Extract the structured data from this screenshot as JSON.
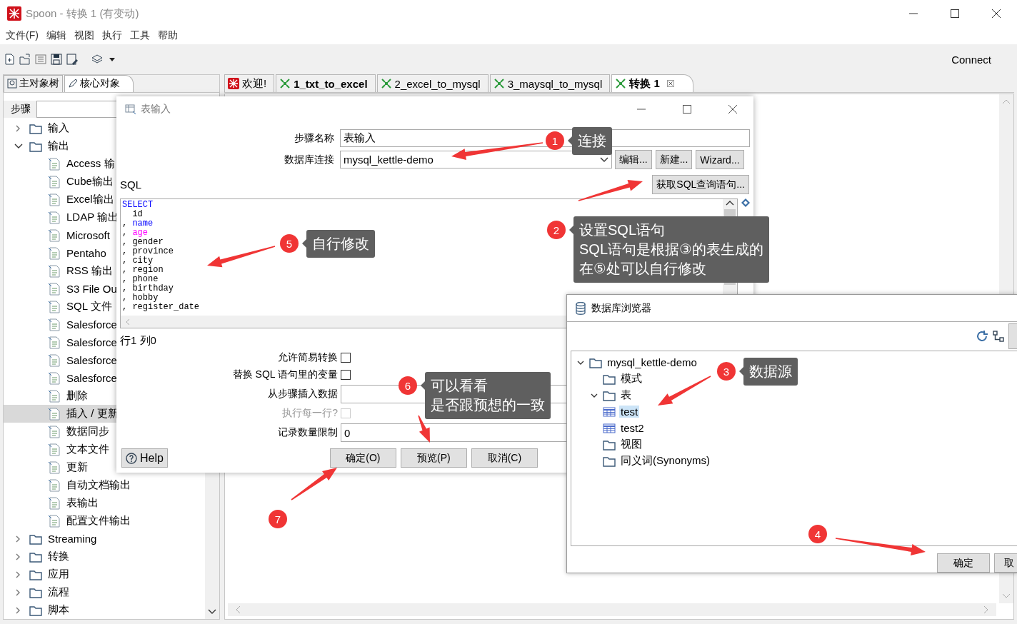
{
  "window": {
    "title": "Spoon - 转换 1 (有变动)"
  },
  "menu": [
    "文件(F)",
    "编辑",
    "视图",
    "执行",
    "工具",
    "帮助"
  ],
  "toolbar": {
    "connect": "Connect"
  },
  "left_panel": {
    "tabs": [
      {
        "label": "主对象树",
        "selected": false
      },
      {
        "label": "核心对象",
        "selected": true
      }
    ],
    "search_label": "步骤",
    "tree": [
      {
        "label": "输入",
        "expanded": false
      },
      {
        "label": "输出",
        "expanded": true,
        "children": [
          {
            "label": "Access 输",
            "selected": false
          },
          {
            "label": "Cube输出",
            "selected": false
          },
          {
            "label": "Excel输出",
            "selected": false
          },
          {
            "label": "LDAP 输出",
            "selected": false
          },
          {
            "label": "Microsoft",
            "selected": false
          },
          {
            "label": "Pentaho",
            "selected": false
          },
          {
            "label": "RSS 输出",
            "selected": false
          },
          {
            "label": "S3 File Ou",
            "selected": false
          },
          {
            "label": "SQL 文件",
            "selected": false
          },
          {
            "label": "Salesforce",
            "selected": false
          },
          {
            "label": "Salesforce",
            "selected": false
          },
          {
            "label": "Salesforce",
            "selected": false
          },
          {
            "label": "Salesforce",
            "selected": false
          },
          {
            "label": "删除",
            "selected": false
          },
          {
            "label": "插入 / 更新",
            "selected": true
          },
          {
            "label": "数据同步",
            "selected": false
          },
          {
            "label": "文本文件",
            "selected": false
          },
          {
            "label": "更新",
            "selected": false
          },
          {
            "label": "自动文档输出",
            "selected": false
          },
          {
            "label": "表输出",
            "selected": false
          },
          {
            "label": "配置文件输出",
            "selected": false
          }
        ]
      },
      {
        "label": "Streaming",
        "expanded": false
      },
      {
        "label": "转换",
        "expanded": false
      },
      {
        "label": "应用",
        "expanded": false
      },
      {
        "label": "流程",
        "expanded": false
      },
      {
        "label": "脚本",
        "expanded": false
      }
    ]
  },
  "canvas_tabs": [
    {
      "label": "欢迎!",
      "kind": "welcome",
      "selected": false,
      "bold": false
    },
    {
      "label": "1_txt_to_excel",
      "kind": "transformation",
      "selected": false,
      "bold": true
    },
    {
      "label": "2_excel_to_mysql",
      "kind": "transformation",
      "selected": false,
      "bold": false
    },
    {
      "label": "3_maysql_to_mysql",
      "kind": "transformation",
      "selected": false,
      "bold": false
    },
    {
      "label": "转换 1",
      "kind": "transformation",
      "selected": true,
      "bold": true,
      "closable": true
    }
  ],
  "table_input_dialog": {
    "title": "表输入",
    "step_name_label": "步骤名称",
    "step_name": "表输入",
    "connection_label": "数据库连接",
    "connection": "mysql_kettle-demo",
    "connection_buttons": [
      "编辑...",
      "新建...",
      "Wizard..."
    ],
    "sql_label": "SQL",
    "get_sql_button": "获取SQL查询语句...",
    "sql_lines": [
      {
        "text": "SELECT",
        "color": "#0000ff"
      },
      {
        "text": "  id",
        "color": "#000000"
      },
      {
        "prefix": ", ",
        "text": "name",
        "color": "#0000ff"
      },
      {
        "prefix": ", ",
        "text": "age",
        "color": "#ff00ff"
      },
      {
        "prefix": ", ",
        "text": "gender",
        "color": "#000000"
      },
      {
        "prefix": ", ",
        "text": "province",
        "color": "#000000"
      },
      {
        "prefix": ", ",
        "text": "city",
        "color": "#000000"
      },
      {
        "prefix": ", ",
        "text": "region",
        "color": "#000000"
      },
      {
        "prefix": ", ",
        "text": "phone",
        "color": "#000000"
      },
      {
        "prefix": ", ",
        "text": "birthday",
        "color": "#000000"
      },
      {
        "prefix": ", ",
        "text": "hobby",
        "color": "#000000"
      },
      {
        "prefix": ", ",
        "text": "register_date",
        "color": "#000000"
      }
    ],
    "cursor_status": "行1 列0",
    "options": [
      {
        "kind": "checkbox",
        "label": "允许简易转换",
        "checked": false,
        "disabled": false
      },
      {
        "kind": "checkbox",
        "label": "替换 SQL 语句里的变量",
        "checked": false,
        "disabled": false
      },
      {
        "kind": "field",
        "label": "从步骤插入数据"
      },
      {
        "kind": "checkbox",
        "label": "执行每一行?",
        "checked": false,
        "disabled": true
      },
      {
        "kind": "field",
        "label": "记录数量限制",
        "value": "0"
      }
    ],
    "help_button": "Help",
    "buttons": [
      "确定(O)",
      "预览(P)",
      "取消(C)"
    ]
  },
  "db_browser": {
    "title": "数据库浏览器",
    "tree": [
      {
        "label": "mysql_kettle-demo",
        "kind": "folder",
        "expanded": true,
        "children": [
          {
            "label": "模式",
            "kind": "folder"
          },
          {
            "label": "表",
            "kind": "folder",
            "expanded": true,
            "children": [
              {
                "label": "test",
                "kind": "table",
                "selected": true
              },
              {
                "label": "test2",
                "kind": "table",
                "selected": false
              }
            ]
          },
          {
            "label": "视图",
            "kind": "folder"
          },
          {
            "label": "同义词(Synonyms)",
            "kind": "folder"
          }
        ]
      }
    ],
    "buttons": [
      "确定",
      "取"
    ]
  },
  "annotations": [
    {
      "number": "1",
      "lines": [
        "连接"
      ]
    },
    {
      "number": "2",
      "lines": [
        "设置SQL语句",
        "SQL语句是根据③的表生成的",
        "在⑤处可以自行修改"
      ]
    },
    {
      "number": "3",
      "lines": [
        "数据源"
      ]
    },
    {
      "number": "4"
    },
    {
      "number": "5",
      "lines": [
        "自行修改"
      ]
    },
    {
      "number": "6",
      "lines": [
        "可以看看",
        "是否跟预想的一致"
      ]
    },
    {
      "number": "7"
    }
  ]
}
